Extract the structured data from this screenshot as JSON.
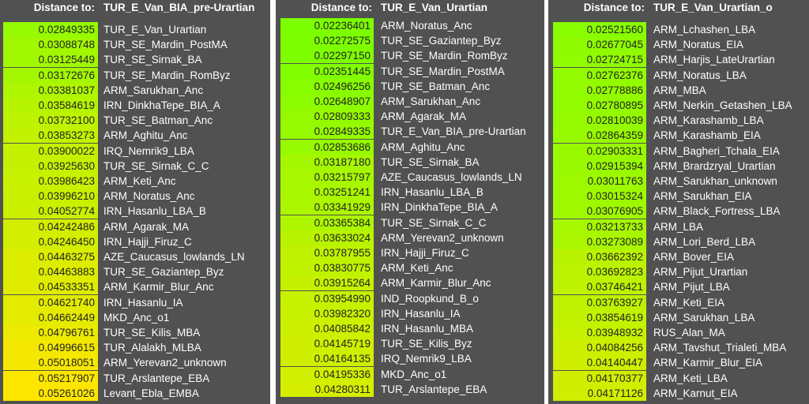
{
  "header_label": "Distance to:",
  "panels": [
    {
      "target": "TUR_E_Van_BIA_pre-Urartian",
      "rows": [
        {
          "value": "0.02849335",
          "name": "TUR_E_Van_Urartian"
        },
        {
          "value": "0.03088748",
          "name": "TUR_SE_Mardin_PostMA"
        },
        {
          "value": "0.03125449",
          "name": "TUR_SE_Sirnak_BA"
        },
        {
          "value": "0.03172676",
          "name": "TUR_SE_Mardin_RomByz"
        },
        {
          "value": "0.03381037",
          "name": "ARM_Sarukhan_Anc"
        },
        {
          "value": "0.03584619",
          "name": "IRN_DinkhaTepe_BIA_A"
        },
        {
          "value": "0.03732100",
          "name": "TUR_SE_Batman_Anc"
        },
        {
          "value": "0.03853273",
          "name": "ARM_Aghitu_Anc"
        },
        {
          "value": "0.03900022",
          "name": "IRQ_Nemrik9_LBA"
        },
        {
          "value": "0.03925630",
          "name": "TUR_SE_Sirnak_C_C"
        },
        {
          "value": "0.03986423",
          "name": "ARM_Keti_Anc"
        },
        {
          "value": "0.03996210",
          "name": "ARM_Noratus_Anc"
        },
        {
          "value": "0.04052774",
          "name": "IRN_Hasanlu_LBA_B"
        },
        {
          "value": "0.04242486",
          "name": "ARM_Agarak_MA"
        },
        {
          "value": "0.04246450",
          "name": "IRN_Hajji_Firuz_C"
        },
        {
          "value": "0.04463275",
          "name": "AZE_Caucasus_lowlands_LN"
        },
        {
          "value": "0.04463883",
          "name": "TUR_SE_Gaziantep_Byz"
        },
        {
          "value": "0.04533351",
          "name": "ARM_Karmir_Blur_Anc"
        },
        {
          "value": "0.04621740",
          "name": "IRN_Hasanlu_IA"
        },
        {
          "value": "0.04662449",
          "name": "MKD_Anc_o1"
        },
        {
          "value": "0.04796761",
          "name": "TUR_SE_Kilis_MBA"
        },
        {
          "value": "0.04996615",
          "name": "TUR_Alalakh_MLBA"
        },
        {
          "value": "0.05018051",
          "name": "ARM_Yerevan2_unknown"
        },
        {
          "value": "0.05217907",
          "name": "TUR_Arslantepe_EBA"
        },
        {
          "value": "0.05261026",
          "name": "Levant_Ebla_EMBA"
        }
      ]
    },
    {
      "target": "TUR_E_Van_Urartian",
      "rows": [
        {
          "value": "0.02236401",
          "name": "ARM_Noratus_Anc"
        },
        {
          "value": "0.02272575",
          "name": "TUR_SE_Gaziantep_Byz"
        },
        {
          "value": "0.02297150",
          "name": "TUR_SE_Mardin_RomByz"
        },
        {
          "value": "0.02351445",
          "name": "TUR_SE_Mardin_PostMA"
        },
        {
          "value": "0.02496256",
          "name": "TUR_SE_Batman_Anc"
        },
        {
          "value": "0.02648907",
          "name": "ARM_Sarukhan_Anc"
        },
        {
          "value": "0.02809333",
          "name": "ARM_Agarak_MA"
        },
        {
          "value": "0.02849335",
          "name": "TUR_E_Van_BIA_pre-Urartian"
        },
        {
          "value": "0.02853686",
          "name": "ARM_Aghitu_Anc"
        },
        {
          "value": "0.03187180",
          "name": "TUR_SE_Sirnak_BA"
        },
        {
          "value": "0.03215797",
          "name": "AZE_Caucasus_lowlands_LN"
        },
        {
          "value": "0.03251241",
          "name": "IRN_Hasanlu_LBA_B"
        },
        {
          "value": "0.03341929",
          "name": "IRN_DinkhaTepe_BIA_A"
        },
        {
          "value": "0.03365384",
          "name": "TUR_SE_Sirnak_C_C"
        },
        {
          "value": "0.03633024",
          "name": "ARM_Yerevan2_unknown"
        },
        {
          "value": "0.03787955",
          "name": "IRN_Hajji_Firuz_C"
        },
        {
          "value": "0.03830775",
          "name": "ARM_Keti_Anc"
        },
        {
          "value": "0.03915264",
          "name": "ARM_Karmir_Blur_Anc"
        },
        {
          "value": "0.03954990",
          "name": "IND_Roopkund_B_o"
        },
        {
          "value": "0.03982320",
          "name": "IRN_Hasanlu_IA"
        },
        {
          "value": "0.04085842",
          "name": "IRN_Hasanlu_MBA"
        },
        {
          "value": "0.04145719",
          "name": "TUR_SE_Kilis_Byz"
        },
        {
          "value": "0.04164135",
          "name": "IRQ_Nemrik9_LBA"
        },
        {
          "value": "0.04195336",
          "name": "MKD_Anc_o1"
        },
        {
          "value": "0.04280311",
          "name": "TUR_Arslantepe_EBA"
        }
      ]
    },
    {
      "target": "TUR_E_Van_Urartian_o",
      "rows": [
        {
          "value": "0.02521560",
          "name": "ARM_Lchashen_LBA"
        },
        {
          "value": "0.02677045",
          "name": "ARM_Noratus_EIA"
        },
        {
          "value": "0.02724715",
          "name": "ARM_Harjis_LateUrartian"
        },
        {
          "value": "0.02762376",
          "name": "ARM_Noratus_LBA"
        },
        {
          "value": "0.02778886",
          "name": "ARM_MBA"
        },
        {
          "value": "0.02780895",
          "name": "ARM_Nerkin_Getashen_LBA"
        },
        {
          "value": "0.02810039",
          "name": "ARM_Karashamb_LBA"
        },
        {
          "value": "0.02864359",
          "name": "ARM_Karashamb_EIA"
        },
        {
          "value": "0.02903331",
          "name": "ARM_Bagheri_Tchala_EIA"
        },
        {
          "value": "0.02915394",
          "name": "ARM_Brardzryal_Urartian"
        },
        {
          "value": "0.03011763",
          "name": "ARM_Sarukhan_unknown"
        },
        {
          "value": "0.03015324",
          "name": "ARM_Sarukhan_EIA"
        },
        {
          "value": "0.03076905",
          "name": "ARM_Black_Fortress_LBA"
        },
        {
          "value": "0.03213733",
          "name": "ARM_LBA"
        },
        {
          "value": "0.03273089",
          "name": "ARM_Lori_Berd_LBA"
        },
        {
          "value": "0.03662392",
          "name": "ARM_Bover_EIA"
        },
        {
          "value": "0.03692823",
          "name": "ARM_Pijut_Urartian"
        },
        {
          "value": "0.03746421",
          "name": "ARM_Pijut_LBA"
        },
        {
          "value": "0.03763927",
          "name": "ARM_Keti_EIA"
        },
        {
          "value": "0.03854619",
          "name": "ARM_Sarukhan_LBA"
        },
        {
          "value": "0.03948932",
          "name": "RUS_Alan_MA"
        },
        {
          "value": "0.04084256",
          "name": "ARM_Tavshut_Trialeti_MBA"
        },
        {
          "value": "0.04140447",
          "name": "ARM_Karmir_Blur_EIA"
        },
        {
          "value": "0.04170377",
          "name": "ARM_Keti_LBA"
        },
        {
          "value": "0.04171126",
          "name": "ARM_Karnut_EIA"
        }
      ]
    }
  ]
}
